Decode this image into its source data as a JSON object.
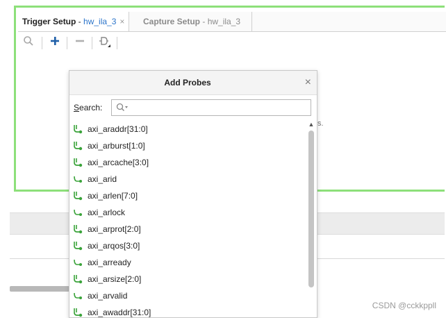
{
  "tabs": {
    "trigger": {
      "prefix": "Trigger Setup",
      "sep": " - ",
      "target": "hw_ila_3",
      "close": "×"
    },
    "capture": {
      "prefix": "Capture Setup",
      "sep": " - ",
      "target": "hw_ila_3"
    }
  },
  "toolbar": {
    "icons": [
      "search-icon",
      "add-icon",
      "remove-icon",
      "probe-compare-icon"
    ]
  },
  "behind": {
    "fragment": "s."
  },
  "dialog": {
    "title": "Add Probes",
    "close": "×",
    "search": {
      "label_u": "S",
      "label_rest": "earch:",
      "value": "",
      "placeholder": ""
    },
    "probes": [
      {
        "label": "axi_araddr[31:0]",
        "kind": "bus"
      },
      {
        "label": "axi_arburst[1:0]",
        "kind": "bus"
      },
      {
        "label": "axi_arcache[3:0]",
        "kind": "bus"
      },
      {
        "label": "axi_arid",
        "kind": "single"
      },
      {
        "label": "axi_arlen[7:0]",
        "kind": "bus"
      },
      {
        "label": "axi_arlock",
        "kind": "single"
      },
      {
        "label": "axi_arprot[2:0]",
        "kind": "bus"
      },
      {
        "label": "axi_arqos[3:0]",
        "kind": "bus"
      },
      {
        "label": "axi_arready",
        "kind": "single"
      },
      {
        "label": "axi_arsize[2:0]",
        "kind": "bus"
      },
      {
        "label": "axi_arvalid",
        "kind": "single"
      },
      {
        "label": "axi_awaddr[31:0]",
        "kind": "bus"
      }
    ]
  },
  "watermark": "CSDN @cckkppll",
  "colors": {
    "frame": "#8de07a",
    "link": "#2a73c9",
    "probe": "#3aa33a"
  }
}
